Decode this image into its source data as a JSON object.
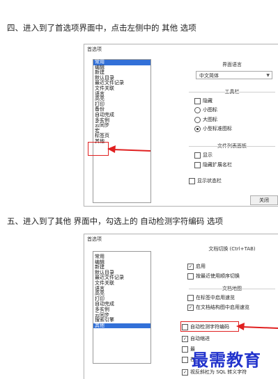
{
  "step1": "四、进入到了首选项界面中，点击左侧中的 其他 选项",
  "step2": "五、进入到了其他 界面中，勾选上的 自动检测字符编码 选项",
  "dialog1": {
    "title": "首选项",
    "categories": [
      "常用",
      "编辑",
      "新建",
      "默认目录",
      "最近文件记录",
      "文件关联",
      "语言",
      "高亮",
      "打印",
      "备份",
      "自动完成",
      "多实例",
      "云同步",
      "宏",
      "标签页",
      "其他"
    ],
    "selected": "常用",
    "language_group": "界面语言",
    "language_value": "中文简体",
    "toolbar_group": "工具栏",
    "toolbar_options": [
      "隐藏",
      "小图标",
      "大图标",
      "小型标准图标"
    ],
    "doclist_group": "文件列表面板",
    "doclist_options": [
      "显示",
      "隐藏扩展名栏"
    ],
    "statusbar": "显示状态栏",
    "close": "关闭"
  },
  "dialog2": {
    "title": "首选项",
    "categories": [
      "常用",
      "编辑",
      "新建",
      "默认目录",
      "最近文件记录",
      "文件关联",
      "语言",
      "高亮",
      "打印",
      "自动完成",
      "多实例",
      "云同步",
      "搜索引擎",
      "其他"
    ],
    "selected": "其他",
    "switch_group": "文档切换 (Ctrl+TAB)",
    "switch_options": [
      "启用",
      "按最近使用顺序切换"
    ],
    "map_group": "文档地图",
    "map_options": [
      "在标签中启用速览",
      "在文档结构图中启用速览"
    ],
    "autodetect": "自动检测字符编码",
    "autoindent": "自动缩进",
    "partial1": "最",
    "partial2": "在",
    "sql": "视反斜杠为 SQL 转义字符"
  },
  "watermark": "最需教育",
  "colors": {
    "selection": "#3270d8",
    "highlight": "#e02020",
    "watermark": "#2233cc"
  }
}
